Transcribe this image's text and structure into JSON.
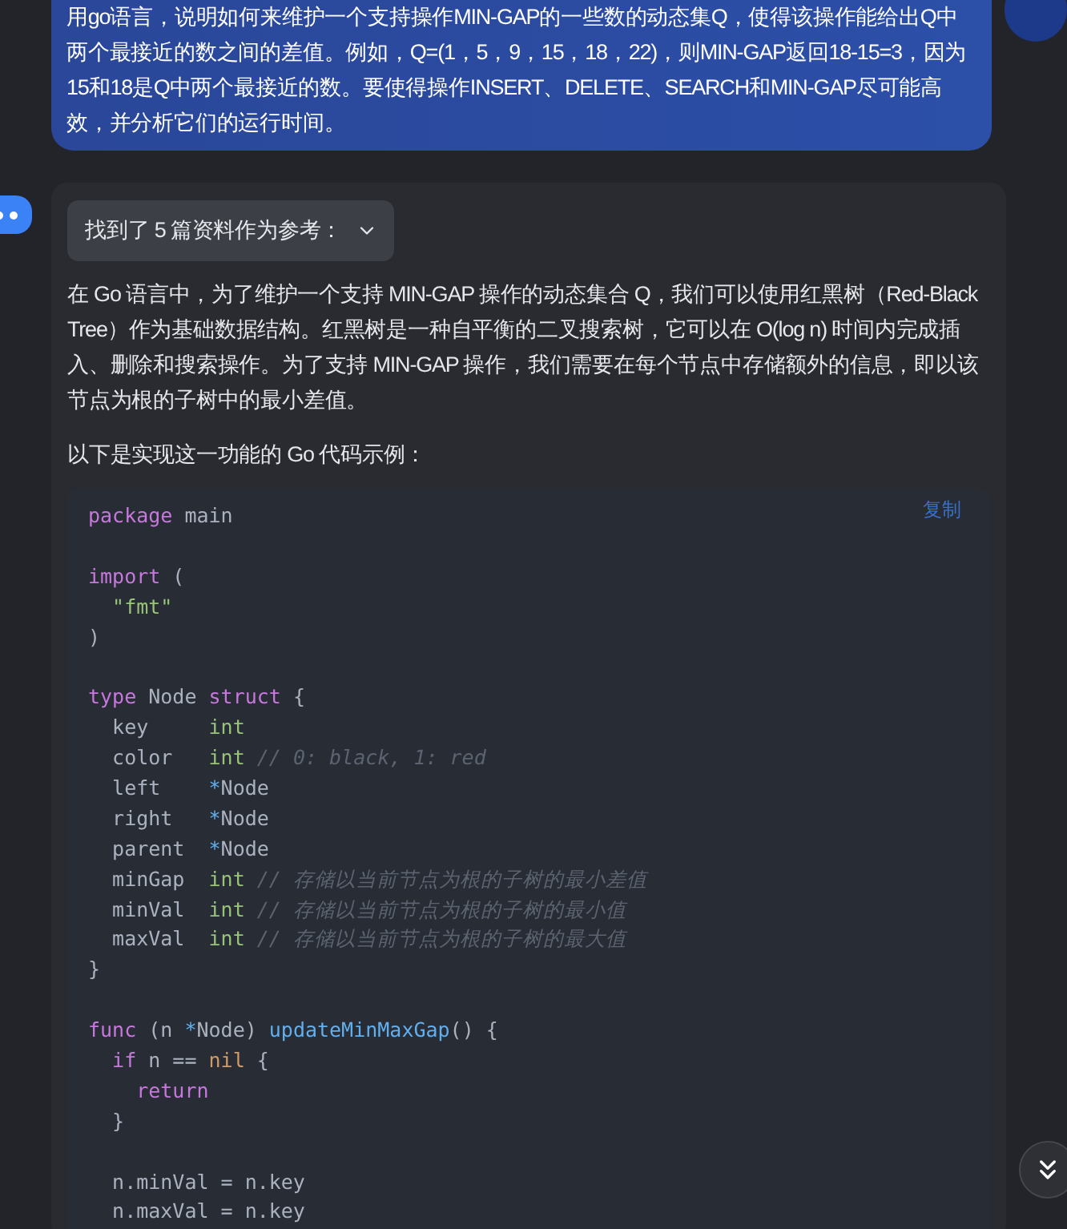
{
  "user_message": {
    "text": "用go语言，说明如何来维护一个支持操作MIN-GAP的一些数的动态集Q，使得该操作能给出Q中两个最接近的数之间的差值。例如，Q=(1，5，9，15，18，22)，则MIN-GAP返回18-15=3，因为15和18是Q中两个最接近的数。要使得操作INSERT、DELETE、SEARCH和MIN-GAP尽可能高效，并分析它们的运行时间。"
  },
  "answer": {
    "sources_toggle": {
      "label": "找到了 5 篇资料作为参考：",
      "expanded": false
    },
    "paragraphs": [
      "在 Go 语言中，为了维护一个支持 MIN-GAP 操作的动态集合 Q，我们可以使用红黑树（Red-Black Tree）作为基础数据结构。红黑树是一种自平衡的二叉搜索树，它可以在 O(log n) 时间内完成插入、删除和搜索操作。为了支持 MIN-GAP 操作，我们需要在每个节点中存储额外的信息，即以该节点为根的子树中的最小差值。",
      "以下是实现这一功能的 Go 代码示例："
    ],
    "code": {
      "copy_label": "复制",
      "lines": [
        {
          "kind": "code",
          "tokens": [
            {
              "text": "package",
              "kind": "kw"
            },
            {
              "text": " main",
              "kind": "plain"
            }
          ]
        },
        {
          "kind": "blank"
        },
        {
          "kind": "code",
          "tokens": [
            {
              "text": "import",
              "kind": "kw"
            },
            {
              "text": " (",
              "kind": "plain"
            }
          ]
        },
        {
          "kind": "code",
          "tokens": [
            {
              "text": "  \"fmt\"",
              "kind": "str"
            }
          ]
        },
        {
          "kind": "code",
          "tokens": [
            {
              "text": ")",
              "kind": "plain"
            }
          ]
        },
        {
          "kind": "blank"
        },
        {
          "kind": "code",
          "tokens": [
            {
              "text": "type",
              "kind": "kw"
            },
            {
              "text": " Node ",
              "kind": "plain"
            },
            {
              "text": "struct",
              "kind": "kw"
            },
            {
              "text": " {",
              "kind": "plain"
            }
          ]
        },
        {
          "kind": "code",
          "tokens": [
            {
              "text": "  key     ",
              "kind": "plain"
            },
            {
              "text": "int",
              "kind": "type"
            }
          ]
        },
        {
          "kind": "code",
          "tokens": [
            {
              "text": "  color   ",
              "kind": "plain"
            },
            {
              "text": "int",
              "kind": "type"
            },
            {
              "text": " // 0: black, 1: red",
              "kind": "comment"
            }
          ]
        },
        {
          "kind": "code",
          "tokens": [
            {
              "text": "  left    ",
              "kind": "plain"
            },
            {
              "text": "*",
              "kind": "op"
            },
            {
              "text": "Node",
              "kind": "plain"
            }
          ]
        },
        {
          "kind": "code",
          "tokens": [
            {
              "text": "  right   ",
              "kind": "plain"
            },
            {
              "text": "*",
              "kind": "op"
            },
            {
              "text": "Node",
              "kind": "plain"
            }
          ]
        },
        {
          "kind": "code",
          "tokens": [
            {
              "text": "  parent  ",
              "kind": "plain"
            },
            {
              "text": "*",
              "kind": "op"
            },
            {
              "text": "Node",
              "kind": "plain"
            }
          ]
        },
        {
          "kind": "code",
          "tokens": [
            {
              "text": "  minGap  ",
              "kind": "plain"
            },
            {
              "text": "int",
              "kind": "type"
            },
            {
              "text": " // 存储以当前节点为根的子树的最小差值",
              "kind": "comment"
            }
          ]
        },
        {
          "kind": "code",
          "tokens": [
            {
              "text": "  minVal  ",
              "kind": "plain"
            },
            {
              "text": "int",
              "kind": "type"
            },
            {
              "text": " // 存储以当前节点为根的子树的最小值",
              "kind": "comment"
            }
          ]
        },
        {
          "kind": "code",
          "tokens": [
            {
              "text": "  maxVal  ",
              "kind": "plain"
            },
            {
              "text": "int",
              "kind": "type"
            },
            {
              "text": " // 存储以当前节点为根的子树的最大值",
              "kind": "comment"
            }
          ]
        },
        {
          "kind": "code",
          "tokens": [
            {
              "text": "}",
              "kind": "plain"
            }
          ]
        },
        {
          "kind": "blank"
        },
        {
          "kind": "code",
          "tokens": [
            {
              "text": "func",
              "kind": "kw"
            },
            {
              "text": " (n ",
              "kind": "plain"
            },
            {
              "text": "*",
              "kind": "op"
            },
            {
              "text": "Node) ",
              "kind": "plain"
            },
            {
              "text": "updateMinMaxGap",
              "kind": "fn"
            },
            {
              "text": "() {",
              "kind": "plain"
            }
          ]
        },
        {
          "kind": "code",
          "tokens": [
            {
              "text": "  if",
              "kind": "kw"
            },
            {
              "text": " n == ",
              "kind": "plain"
            },
            {
              "text": "nil",
              "kind": "nil"
            },
            {
              "text": " {",
              "kind": "plain"
            }
          ]
        },
        {
          "kind": "code",
          "tokens": [
            {
              "text": "    return",
              "kind": "kw"
            }
          ]
        },
        {
          "kind": "code",
          "tokens": [
            {
              "text": "  }",
              "kind": "plain"
            }
          ]
        },
        {
          "kind": "blank"
        },
        {
          "kind": "code",
          "tokens": [
            {
              "text": "  n.minVal = n.key",
              "kind": "plain"
            }
          ]
        },
        {
          "kind": "code",
          "tokens": [
            {
              "text": "  n.maxVal = n.key",
              "kind": "plain"
            }
          ]
        }
      ]
    }
  }
}
